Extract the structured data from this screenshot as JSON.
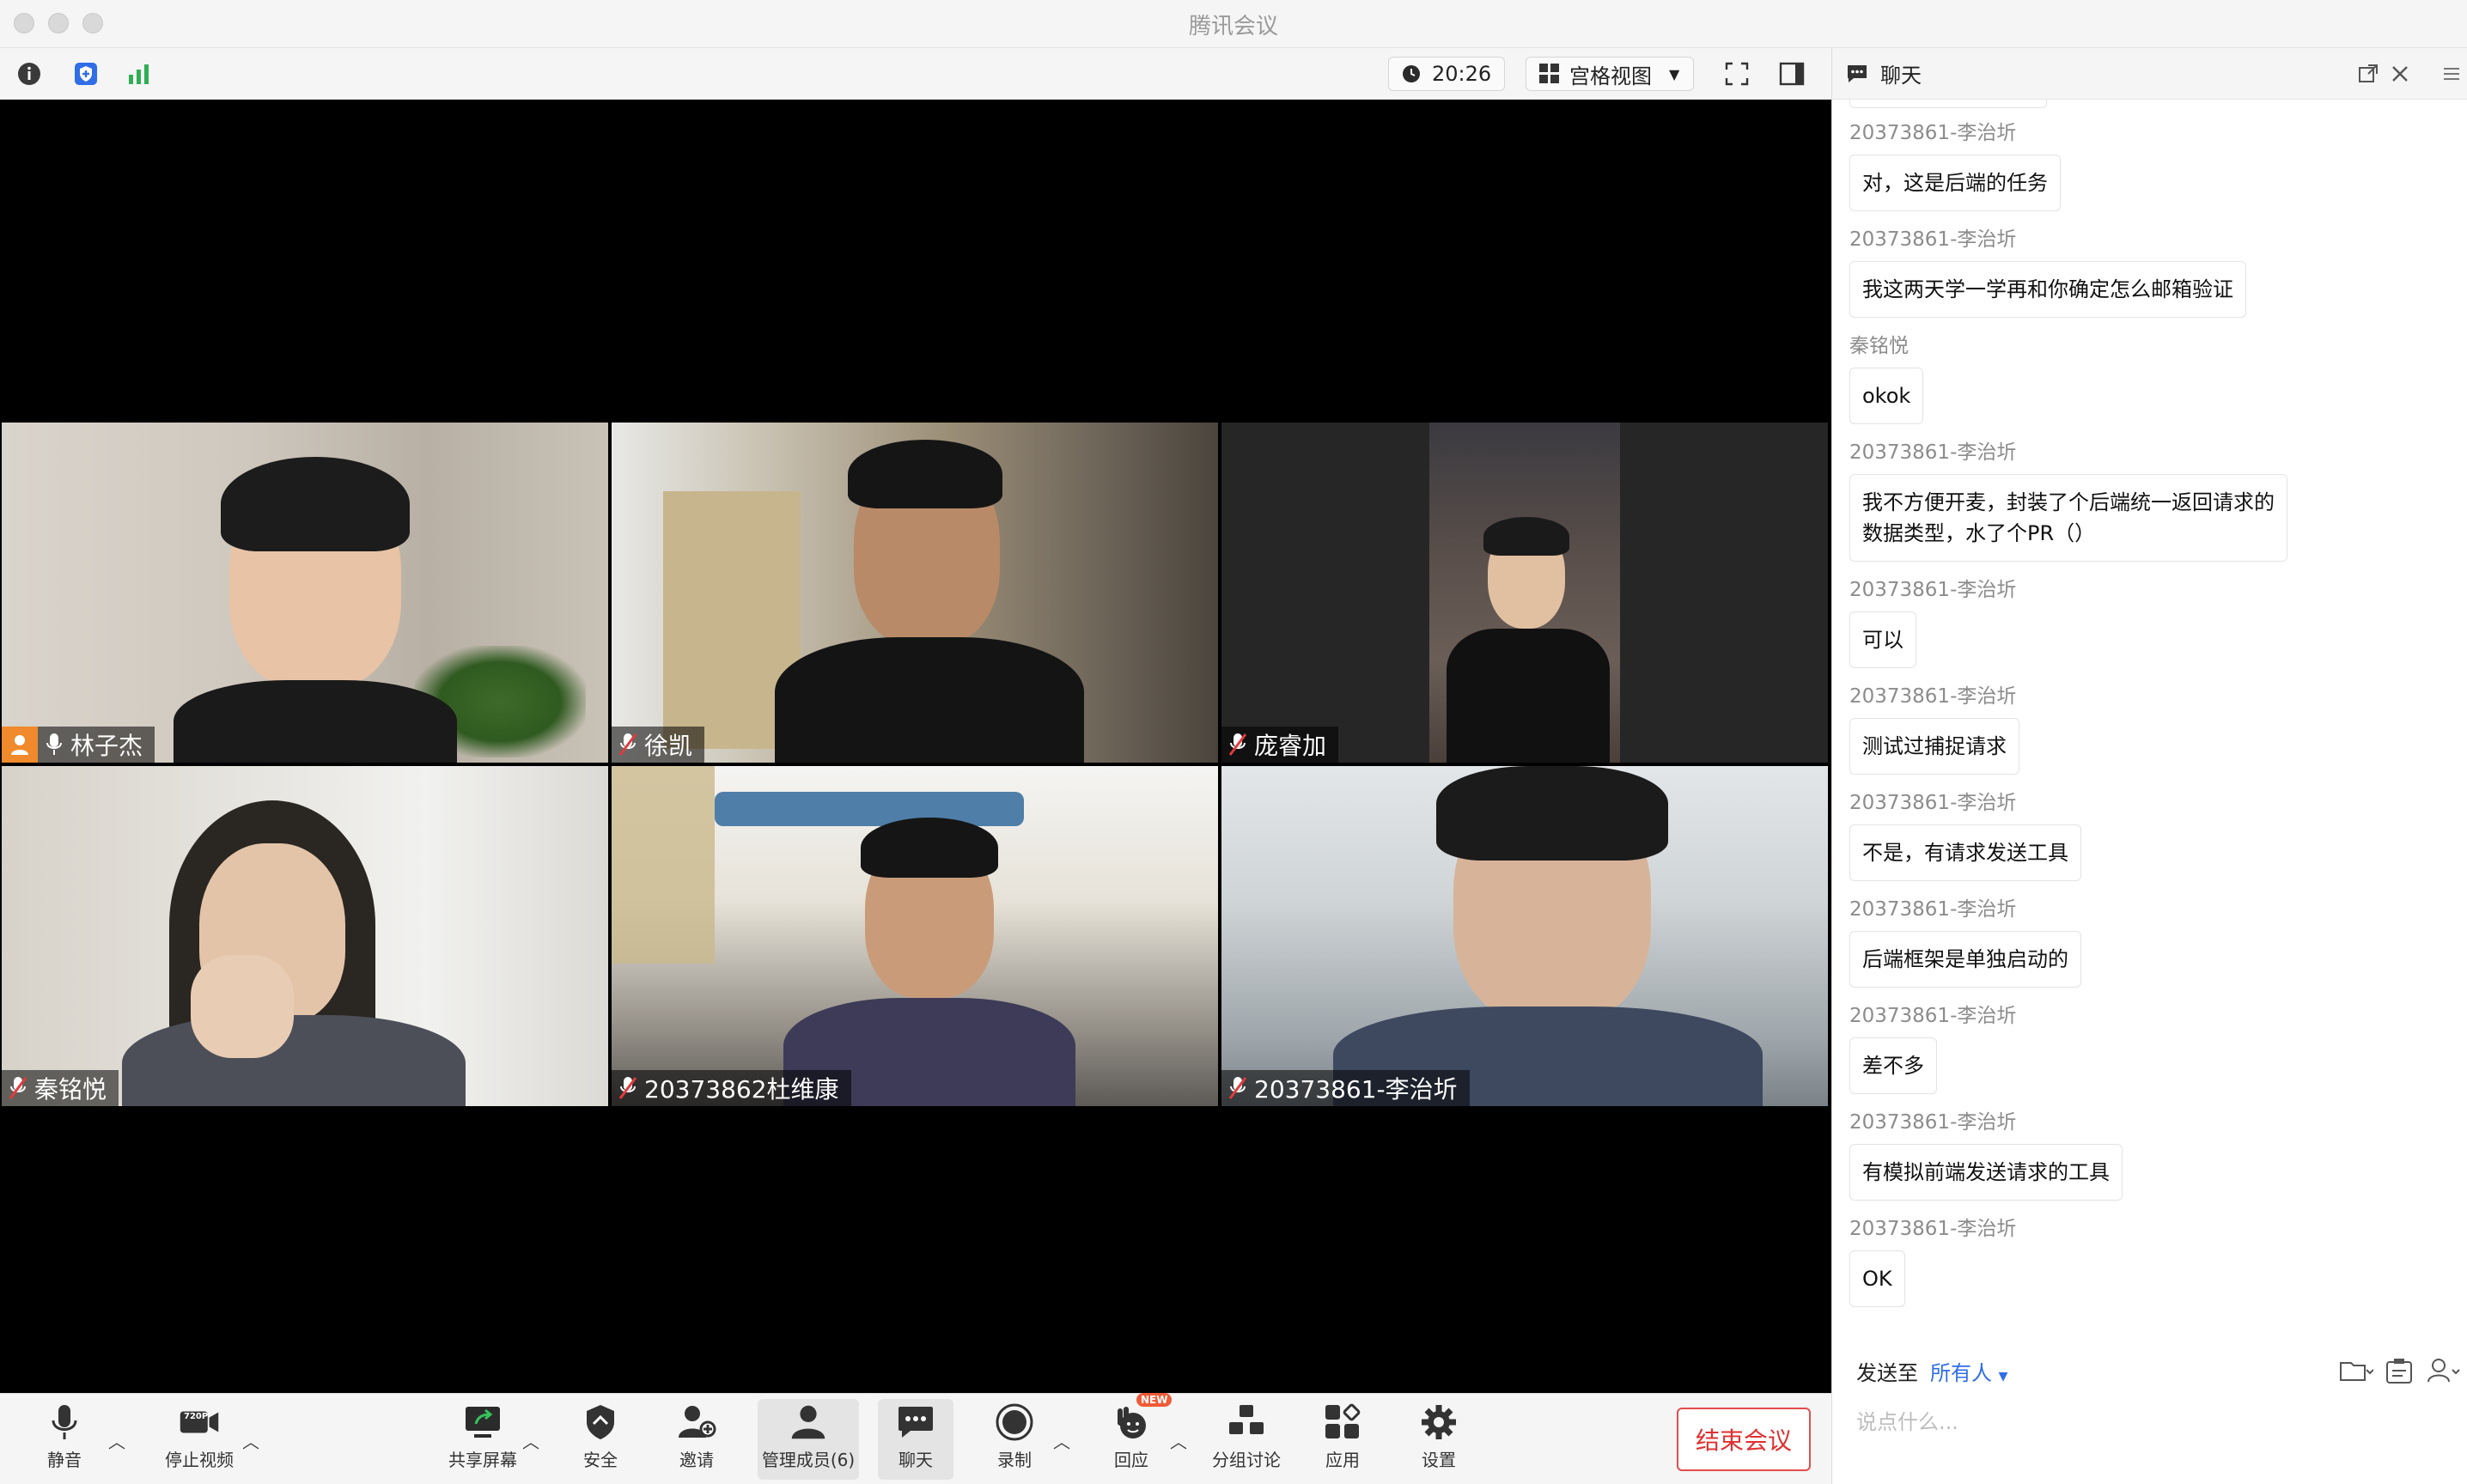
{
  "window": {
    "title": "腾讯会议"
  },
  "topbar": {
    "timer": "20:26",
    "view_label": "宫格视图",
    "icons": [
      "info-icon",
      "shield-icon",
      "signal-icon",
      "clock-icon",
      "grid-icon",
      "fullscreen-icon",
      "sidebar-icon"
    ]
  },
  "participants": [
    {
      "name": "林子杰",
      "muted": false,
      "host": true,
      "active_speaker": true
    },
    {
      "name": "徐凯",
      "muted": true
    },
    {
      "name": "庞睿加",
      "muted": true
    },
    {
      "name": "秦铭悦",
      "muted": true
    },
    {
      "name": "20373862杜维康",
      "muted": true
    },
    {
      "name": "20373861-李治圻",
      "muted": true
    }
  ],
  "chat": {
    "title": "聊天",
    "messages": [
      {
        "sender": "20373861-李治圻",
        "text": "对，这是后端的任务"
      },
      {
        "sender": "20373861-李治圻",
        "text": "我这两天学一学再和你确定怎么邮箱验证"
      },
      {
        "sender": "秦铭悦",
        "text": "okok"
      },
      {
        "sender": "20373861-李治圻",
        "text": "我不方便开麦，封装了个后端统一返回请求的数据类型，水了个PR（）"
      },
      {
        "sender": "20373861-李治圻",
        "text": "可以"
      },
      {
        "sender": "20373861-李治圻",
        "text": "测试过捕捉请求"
      },
      {
        "sender": "20373861-李治圻",
        "text": "不是，有请求发送工具"
      },
      {
        "sender": "20373861-李治圻",
        "text": "后端框架是单独启动的"
      },
      {
        "sender": "20373861-李治圻",
        "text": "差不多"
      },
      {
        "sender": "20373861-李治圻",
        "text": "有模拟前端发送请求的工具"
      },
      {
        "sender": "20373861-李治圻",
        "text": "OK"
      }
    ],
    "send_to_label": "发送至",
    "send_to_value": "所有人",
    "input_placeholder": "说点什么..."
  },
  "bottombar": {
    "mute": "静音",
    "stop_video": "停止视频",
    "video_badge": "720P",
    "share_screen": "共享屏幕",
    "security": "安全",
    "invite": "邀请",
    "manage_members": "管理成员(6)",
    "chat": "聊天",
    "record": "录制",
    "react": "回应",
    "react_badge": "NEW",
    "breakout": "分组讨论",
    "apps": "应用",
    "settings": "设置",
    "end_meeting": "结束会议"
  },
  "colors": {
    "active_speaker": "#3ec251",
    "end_meeting": "#e02f2f",
    "accent": "#2f6ee6"
  }
}
